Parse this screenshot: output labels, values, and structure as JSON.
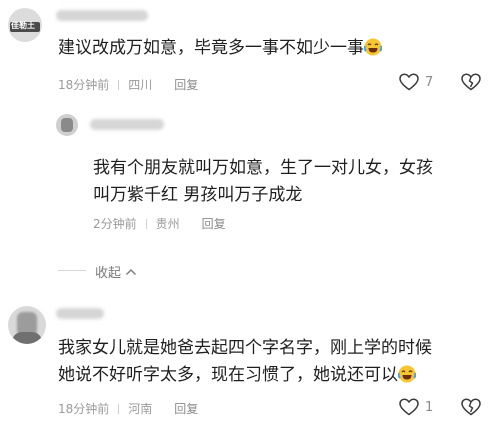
{
  "comments": [
    {
      "text": "建议改成万如意，毕竟多一事不如少一事",
      "time": "18分钟前",
      "location": "四川",
      "reply_label": "回复",
      "likes": "7",
      "emoji": "laughing-crying"
    },
    {
      "text_line1": "我有个朋友就叫万如意，生了一对儿女，女孩",
      "text_line2": "叫万紫千红 男孩叫万子成龙",
      "time": "2分钟前",
      "location": "贵州",
      "reply_label": "回复"
    },
    {
      "text_line1": "我家女儿就是她爸去起四个字名字，刚上学的时候",
      "text_line2": "她说不好听字太多，现在习惯了，她说还可以",
      "time": "18分钟前",
      "location": "河南",
      "reply_label": "回复",
      "likes": "1",
      "emoji": "laughing-crying"
    }
  ],
  "collapse_label": "收起",
  "avatar_text": "佳勒土",
  "colors": {
    "meta": "#9a9a9a",
    "text": "#1e1e1e",
    "divider": "#d8d8d8"
  },
  "icons": [
    "heart-outline-icon",
    "broken-heart-icon",
    "chevron-up-icon",
    "laughing-crying-emoji"
  ]
}
